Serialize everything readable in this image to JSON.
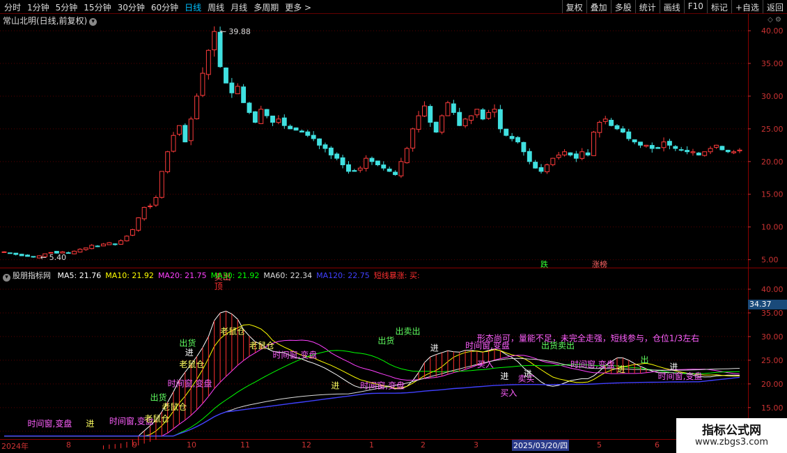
{
  "toolbar": {
    "periods": [
      "分时",
      "1分钟",
      "5分钟",
      "15分钟",
      "30分钟",
      "60分钟",
      "日线",
      "周线",
      "月线",
      "多周期",
      "更多 >"
    ],
    "active_index": 6,
    "right": [
      "复权",
      "叠加",
      "多股",
      "统计",
      "画线",
      "F10",
      "标记",
      "+自选",
      "返回"
    ]
  },
  "chart_title": "常山北明(日线,前复权)",
  "indicator": {
    "name": "股朋指标网",
    "ma": [
      {
        "label": "MA5: 21.76",
        "color": "#ffffff"
      },
      {
        "label": "MA10: 21.92",
        "color": "#ffff00"
      },
      {
        "label": "MA20: 21.75",
        "color": "#ff40ff"
      },
      {
        "label": "MA30: 21.92",
        "color": "#00ff00"
      },
      {
        "label": "MA60: 22.34",
        "color": "#dddddd"
      },
      {
        "label": "MA120: 22.75",
        "color": "#4040ff"
      }
    ],
    "signal": "短线暴涨: 买:"
  },
  "tags": {
    "die": "跌",
    "zhangting": "涨榜"
  },
  "current_price": "34.37",
  "date_axis": [
    {
      "label": "2024年"
    },
    {
      "label": "8"
    },
    {
      "label": "9"
    },
    {
      "label": "10"
    },
    {
      "label": "11"
    },
    {
      "label": "12"
    },
    {
      "label": "1"
    },
    {
      "label": "2"
    },
    {
      "label": "3"
    },
    {
      "label": "2025/03/20/四",
      "highlight": true
    },
    {
      "label": "5"
    },
    {
      "label": "6"
    }
  ],
  "watermark": {
    "line1": "指标公式网",
    "line2": "www.zbgs3.com"
  },
  "chart_data": [
    {
      "type": "candlestick",
      "y_axis_ticks": [
        "40.00",
        "35.00",
        "30.00",
        "25.00",
        "20.00",
        "15.00",
        "10.00",
        "5.00"
      ],
      "ylim": [
        4.0,
        41.5
      ],
      "high_label": "39.88",
      "low_label": "5.40",
      "close_path": [
        6.2,
        6.0,
        5.8,
        5.6,
        5.5,
        5.4,
        5.6,
        5.9,
        6.1,
        6.0,
        6.2,
        6.0,
        6.3,
        6.6,
        6.8,
        7.2,
        7.0,
        7.4,
        7.6,
        7.3,
        7.9,
        8.6,
        9.6,
        11.4,
        13.0,
        13.2,
        14.5,
        18.5,
        21.5,
        24.0,
        25.5,
        23.0,
        26.5,
        30.0,
        33.5,
        37.0,
        39.88,
        34.5,
        32.0,
        30.5,
        31.5,
        29.0,
        27.5,
        26.0,
        28.0,
        27.0,
        26.0,
        26.5,
        25.5,
        25.0,
        24.8,
        24.5,
        24.0,
        23.5,
        22.5,
        22.0,
        21.0,
        20.5,
        19.5,
        18.5,
        18.5,
        19.0,
        20.5,
        20.0,
        19.5,
        19.0,
        18.5,
        18.0,
        20.0,
        22.0,
        25.0,
        27.0,
        28.5,
        26.0,
        24.5,
        27.0,
        29.0,
        27.5,
        25.5,
        26.5,
        27.0,
        28.0,
        26.5,
        27.5,
        28.0,
        25.0,
        24.0,
        23.5,
        23.0,
        21.5,
        20.0,
        19.0,
        18.5,
        19.5,
        20.5,
        21.0,
        21.5,
        21.0,
        20.5,
        21.5,
        21.0,
        24.5,
        26.0,
        26.5,
        25.5,
        25.0,
        24.5,
        23.5,
        23.0,
        22.5,
        22.5,
        22.0,
        22.0,
        23.0,
        22.5,
        22.0,
        21.8,
        21.5,
        21.5,
        21.0,
        21.5,
        22.0,
        22.5,
        21.8,
        21.5,
        21.5,
        21.76
      ]
    },
    {
      "type": "line",
      "y_axis_ticks": [
        "40.00",
        "35.00",
        "30.00",
        "25.00",
        "20.00",
        "15.00",
        "10.00"
      ],
      "ylim": [
        8.5,
        42.5
      ],
      "series": [
        {
          "name": "MA5",
          "color": "#ffffff"
        },
        {
          "name": "MA10",
          "color": "#ffff00"
        },
        {
          "name": "MA20",
          "color": "#ff40ff"
        },
        {
          "name": "MA30",
          "color": "#00ff00"
        },
        {
          "name": "MA60",
          "color": "#dddddd"
        },
        {
          "name": "MA120",
          "color": "#4040ff"
        }
      ],
      "annotations": [
        {
          "text": "顶",
          "x": 36,
          "y": 40.0,
          "color": "#ff3030"
        },
        {
          "text": "卖出",
          "x": 36,
          "y": 42.0,
          "color": "#ff6060"
        },
        {
          "text": "老鼠仓",
          "x": 37,
          "y": 30.5,
          "color": "#ffff60"
        },
        {
          "text": "老鼠仓",
          "x": 30,
          "y": 23.5,
          "color": "#ffff60"
        },
        {
          "text": "时间窗,变盘",
          "x": 28,
          "y": 19.5,
          "color": "#ff60ff"
        },
        {
          "text": "出货",
          "x": 30,
          "y": 28.0,
          "color": "#60ff60"
        },
        {
          "text": "进",
          "x": 31,
          "y": 26.0,
          "color": "#ffffff"
        },
        {
          "text": "老鼠仓",
          "x": 42,
          "y": 27.5,
          "color": "#ffff60"
        },
        {
          "text": "时间窗,变盘",
          "x": 46,
          "y": 25.5,
          "color": "#ff60ff"
        },
        {
          "text": "进",
          "x": 56,
          "y": 19.0,
          "color": "#ffff60"
        },
        {
          "text": "时间窗,变盘",
          "x": 61,
          "y": 19.0,
          "color": "#ff60ff"
        },
        {
          "text": "出卖出",
          "x": 67,
          "y": 30.5,
          "color": "#60ff60"
        },
        {
          "text": "出货",
          "x": 64,
          "y": 28.5,
          "color": "#60ff60"
        },
        {
          "text": "进",
          "x": 73,
          "y": 27.0,
          "color": "#ffffff"
        },
        {
          "text": "时间窗,变盘",
          "x": 79,
          "y": 27.5,
          "color": "#ff60ff"
        },
        {
          "text": "买入",
          "x": 81,
          "y": 23.5,
          "color": "#ff60ff"
        },
        {
          "text": "进",
          "x": 85,
          "y": 21.0,
          "color": "#ffffff"
        },
        {
          "text": "卖买",
          "x": 88,
          "y": 20.5,
          "color": "#ff60ff"
        },
        {
          "text": "买入",
          "x": 85,
          "y": 17.5,
          "color": "#ff60ff"
        },
        {
          "text": "进",
          "x": 89,
          "y": 21.5,
          "color": "#ffffff"
        },
        {
          "text": "出货卖出",
          "x": 92,
          "y": 27.5,
          "color": "#60ff60"
        },
        {
          "text": "时间窗,变盘",
          "x": 97,
          "y": 23.5,
          "color": "#ff60ff"
        },
        {
          "text": "进",
          "x": 105,
          "y": 22.5,
          "color": "#ffff60"
        },
        {
          "text": "时间窗,变盘",
          "x": 112,
          "y": 21.0,
          "color": "#ff60ff"
        },
        {
          "text": "形态尚可，量能不足，未完全走强，短线参与，仓位1/3左右",
          "x": 81,
          "y": 29.0,
          "color": "#ff60ff"
        },
        {
          "text": "出",
          "x": 109,
          "y": 24.5,
          "color": "#60ff60"
        },
        {
          "text": "进",
          "x": 114,
          "y": 23.0,
          "color": "#ffffff"
        },
        {
          "text": "时间窗,变盘",
          "x": 4,
          "y": 11.0,
          "color": "#ff60ff"
        },
        {
          "text": "进",
          "x": 14,
          "y": 11.0,
          "color": "#ffff60"
        },
        {
          "text": "时间窗,变盘",
          "x": 18,
          "y": 11.5,
          "color": "#ff60ff"
        },
        {
          "text": "老鼠仓",
          "x": 24,
          "y": 12.0,
          "color": "#ffff60"
        },
        {
          "text": "老鼠仓",
          "x": 27,
          "y": 14.5,
          "color": "#ffff60"
        },
        {
          "text": "出货",
          "x": 25,
          "y": 16.5,
          "color": "#60ff60"
        }
      ]
    }
  ]
}
